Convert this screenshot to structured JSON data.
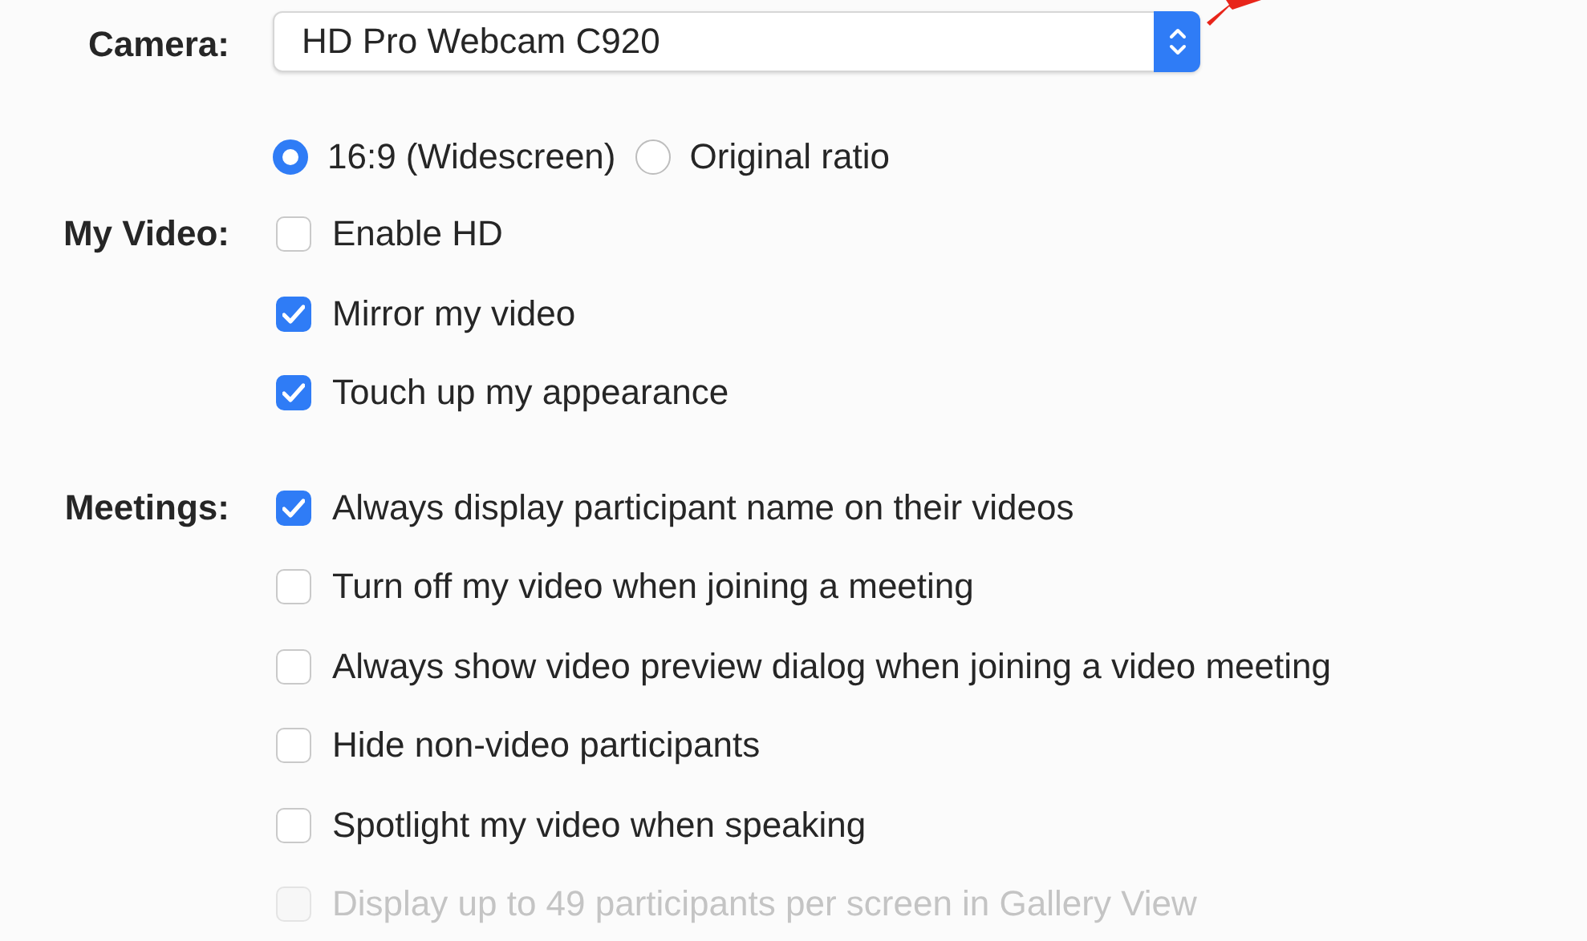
{
  "camera": {
    "label": "Camera:",
    "value": "HD Pro Webcam C920"
  },
  "aspect_ratio": [
    {
      "label": "16:9 (Widescreen)",
      "selected": true
    },
    {
      "label": "Original ratio",
      "selected": false
    }
  ],
  "sections": [
    {
      "label": "My Video:",
      "options": [
        {
          "label": "Enable HD",
          "checked": false,
          "disabled": false
        },
        {
          "label": "Mirror my video",
          "checked": true,
          "disabled": false
        },
        {
          "label": "Touch up my appearance",
          "checked": true,
          "disabled": false
        }
      ]
    },
    {
      "label": "Meetings:",
      "options": [
        {
          "label": "Always display participant name on their videos",
          "checked": true,
          "disabled": false
        },
        {
          "label": "Turn off my video when joining a meeting",
          "checked": false,
          "disabled": false
        },
        {
          "label": "Always show video preview dialog when joining a video meeting",
          "checked": false,
          "disabled": false
        },
        {
          "label": "Hide non-video participants",
          "checked": false,
          "disabled": false
        },
        {
          "label": "Spotlight my video when speaking",
          "checked": false,
          "disabled": false
        },
        {
          "label": "Display up to 49 participants per screen in Gallery View",
          "checked": false,
          "disabled": true
        }
      ]
    }
  ]
}
